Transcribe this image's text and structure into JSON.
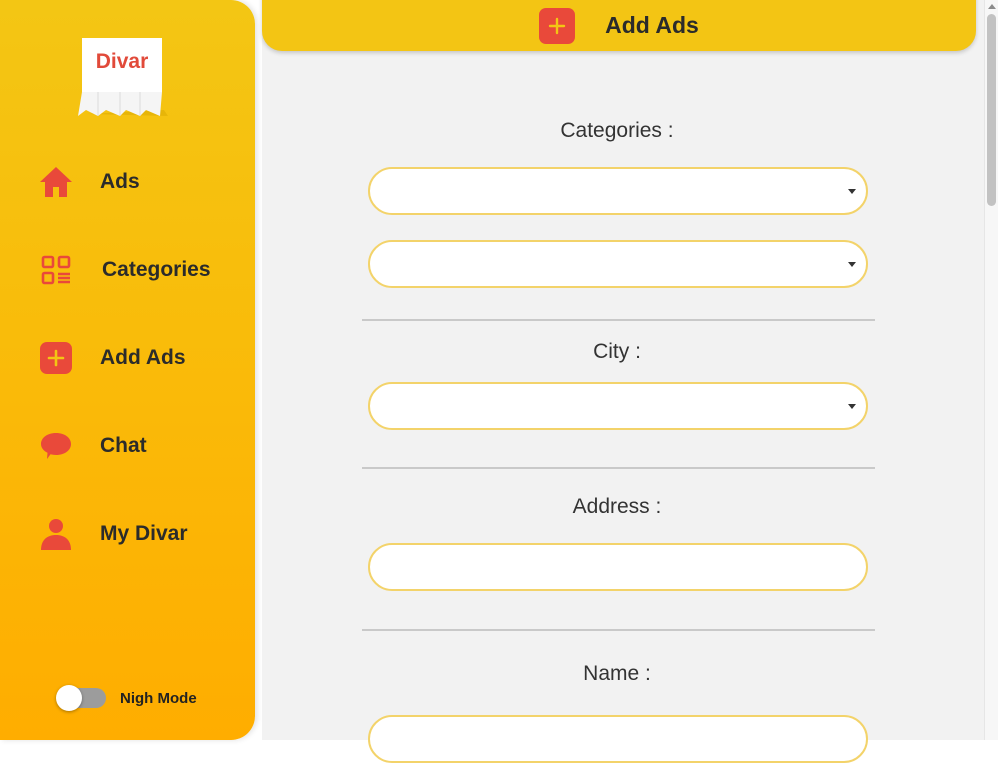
{
  "sidebar": {
    "logo_text": "Divar",
    "items": [
      {
        "label": "Ads",
        "icon": "home-icon"
      },
      {
        "label": "Categories",
        "icon": "categories-icon"
      },
      {
        "label": "Add Ads",
        "icon": "add-icon"
      },
      {
        "label": "Chat",
        "icon": "chat-icon"
      },
      {
        "label": "My Divar",
        "icon": "user-icon"
      }
    ],
    "night_mode_label": "Nigh Mode",
    "night_mode_on": false
  },
  "header": {
    "title": "Add Ads",
    "icon": "add-icon"
  },
  "form": {
    "categories_label": "Categories :",
    "category_value": "",
    "subcategory_value": "",
    "city_label": "City :",
    "city_value": "",
    "address_label": "Address :",
    "address_value": "",
    "name_label": "Name :",
    "name_value": ""
  },
  "colors": {
    "accent": "#f3c514",
    "icon_red": "#e9493a",
    "field_border": "#f3d36a",
    "main_bg": "#f2f2f2"
  }
}
